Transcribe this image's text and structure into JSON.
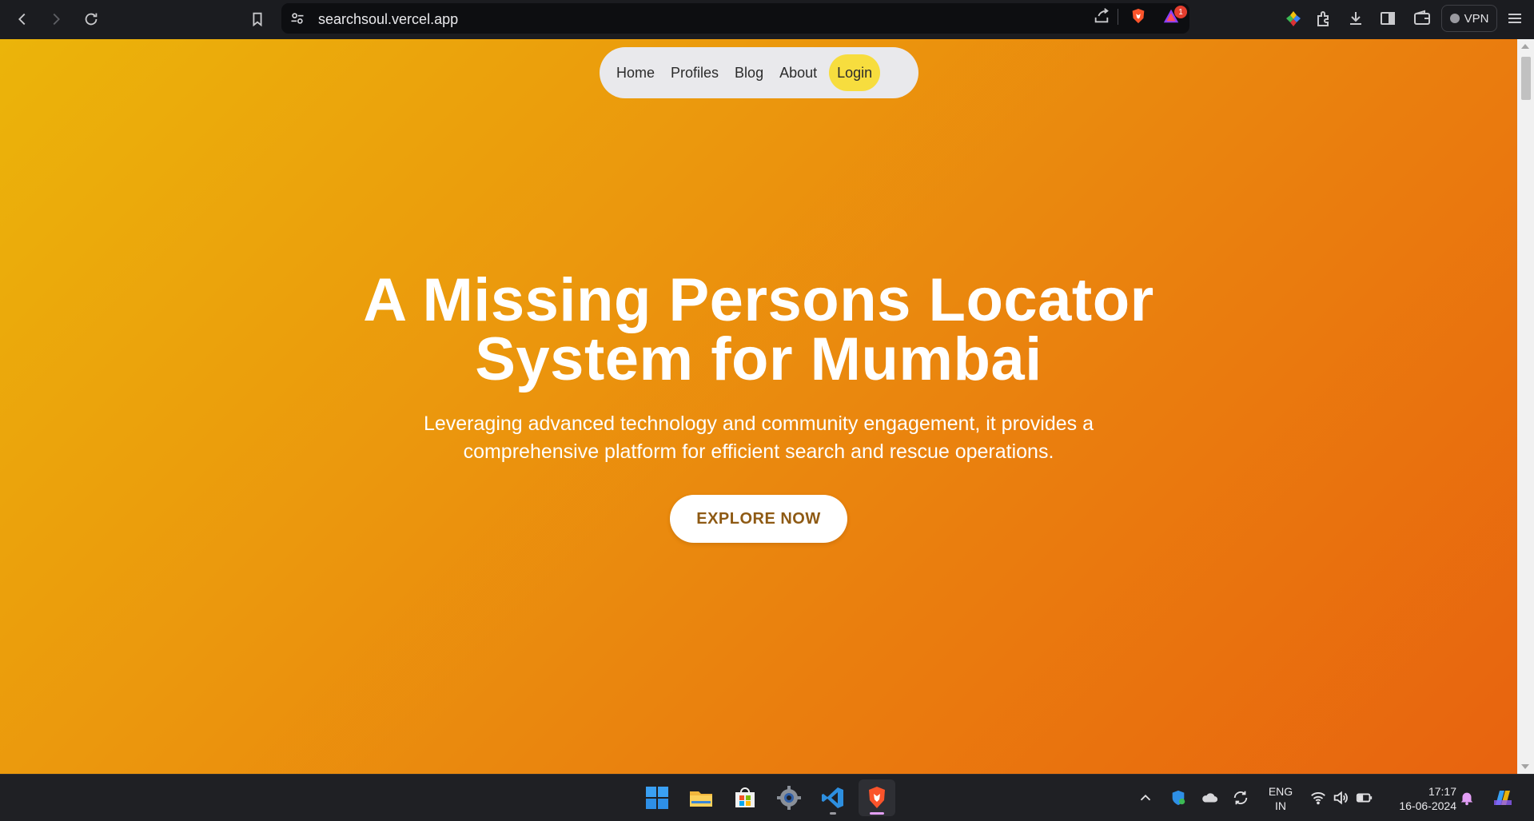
{
  "browser": {
    "url": "searchsoul.vercel.app",
    "notification_count": "1",
    "vpn_label": "VPN"
  },
  "site": {
    "nav": {
      "home": "Home",
      "profiles": "Profiles",
      "blog": "Blog",
      "about": "About",
      "login": "Login"
    },
    "hero": {
      "title_line1": "A Missing Persons Locator",
      "title_line2": "System for Mumbai",
      "subtitle_line1": "Leveraging advanced technology and community engagement, it provides a",
      "subtitle_line2": "comprehensive platform for efficient search and rescue operations.",
      "cta_label": "EXPLORE NOW"
    },
    "colors": {
      "gradient_start": "#ebb40a",
      "gradient_end": "#e8630f",
      "login_highlight": "#f7dd3e",
      "cta_text": "#8e5a14"
    }
  },
  "taskbar": {
    "apps": [
      "windows-start",
      "file-explorer",
      "microsoft-store",
      "settings",
      "vs-code",
      "brave-browser"
    ],
    "language_line1": "ENG",
    "language_line2": "IN",
    "time": "17:17",
    "date": "16-06-2024"
  }
}
